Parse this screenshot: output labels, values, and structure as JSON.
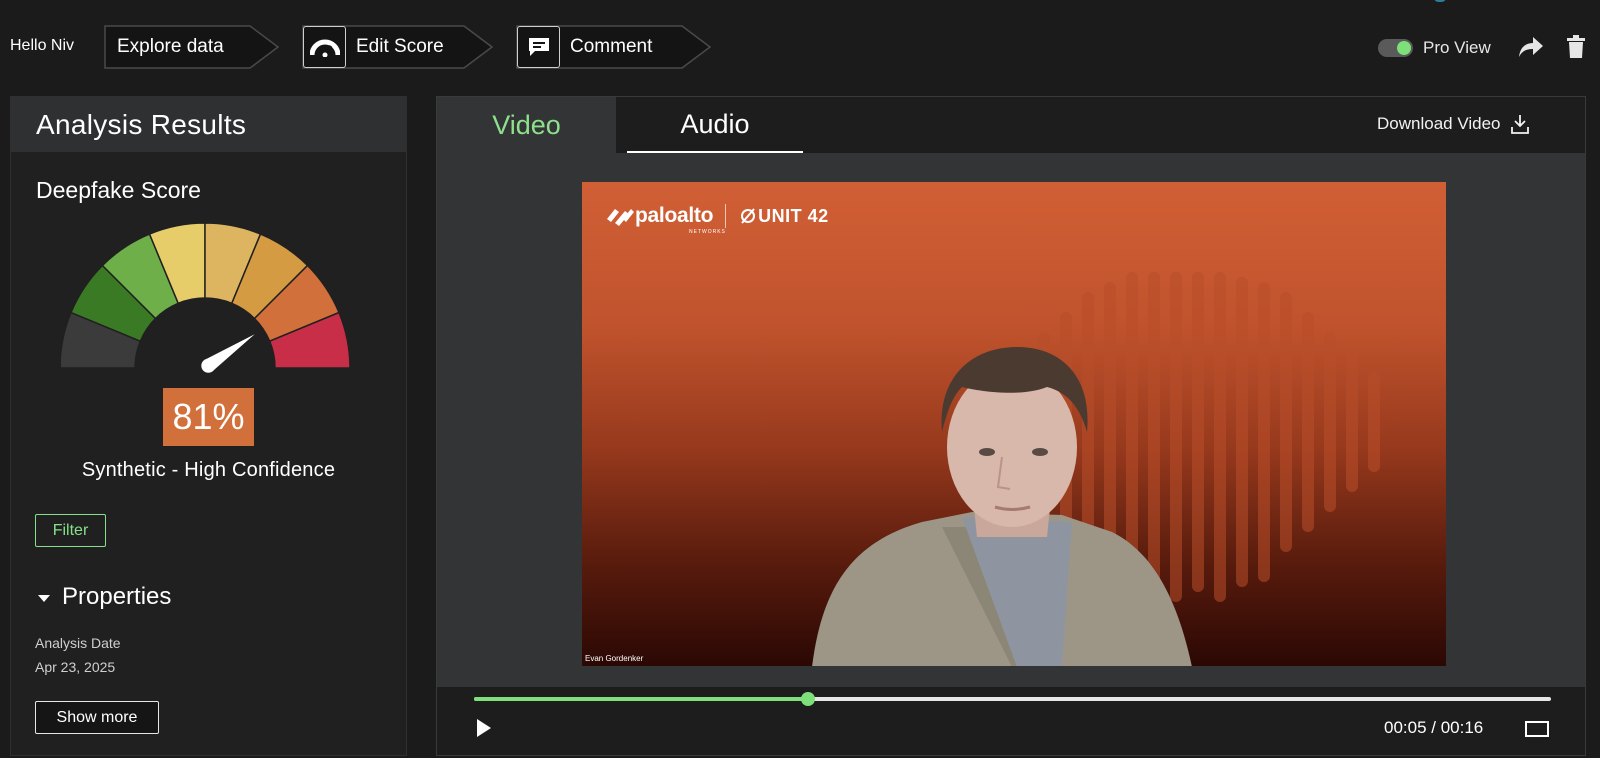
{
  "header": {
    "greeting": "Hello Niv",
    "breadcrumbs": [
      {
        "label": "Explore data",
        "icon": ""
      },
      {
        "label": "Edit Score",
        "icon": "gauge-icon"
      },
      {
        "label": "Comment",
        "icon": "comment-icon"
      }
    ],
    "pro_view": {
      "label": "Pro View",
      "enabled": true
    },
    "actions": {
      "share_icon": "share-icon",
      "delete_icon": "trash-icon"
    }
  },
  "analysis": {
    "title": "Analysis Results",
    "score_title": "Deepfake Score",
    "score_value": 81,
    "score_text": "81%",
    "verdict": "Synthetic - High Confidence",
    "filter_label": "Filter",
    "properties": {
      "heading": "Properties",
      "items": [
        {
          "label": "Analysis Date",
          "value": "Apr 23, 2025"
        }
      ]
    },
    "show_more_label": "Show more",
    "gauge_colors": [
      "#3b3b3b",
      "#3a7a25",
      "#6faf4a",
      "#e6cd6a",
      "#ddb561",
      "#d49b43",
      "#d2703c",
      "#c92e48"
    ]
  },
  "media": {
    "tabs": [
      {
        "label": "Video",
        "active": true
      },
      {
        "label": "Audio",
        "active": false
      }
    ],
    "download_label": "Download Video",
    "video": {
      "logo_brand": "paloalto",
      "logo_brand_sub": "NETWORKS",
      "logo_unit": "UNIT 42",
      "caption": "Evan Gordenker"
    },
    "player": {
      "current": "00:05",
      "duration": "00:16",
      "time_text": "00:05 / 00:16",
      "progress": 0.31
    }
  },
  "colors": {
    "accent_green": "#7de07a",
    "score_orange": "#d2703c",
    "background": "#1b1b1b"
  }
}
